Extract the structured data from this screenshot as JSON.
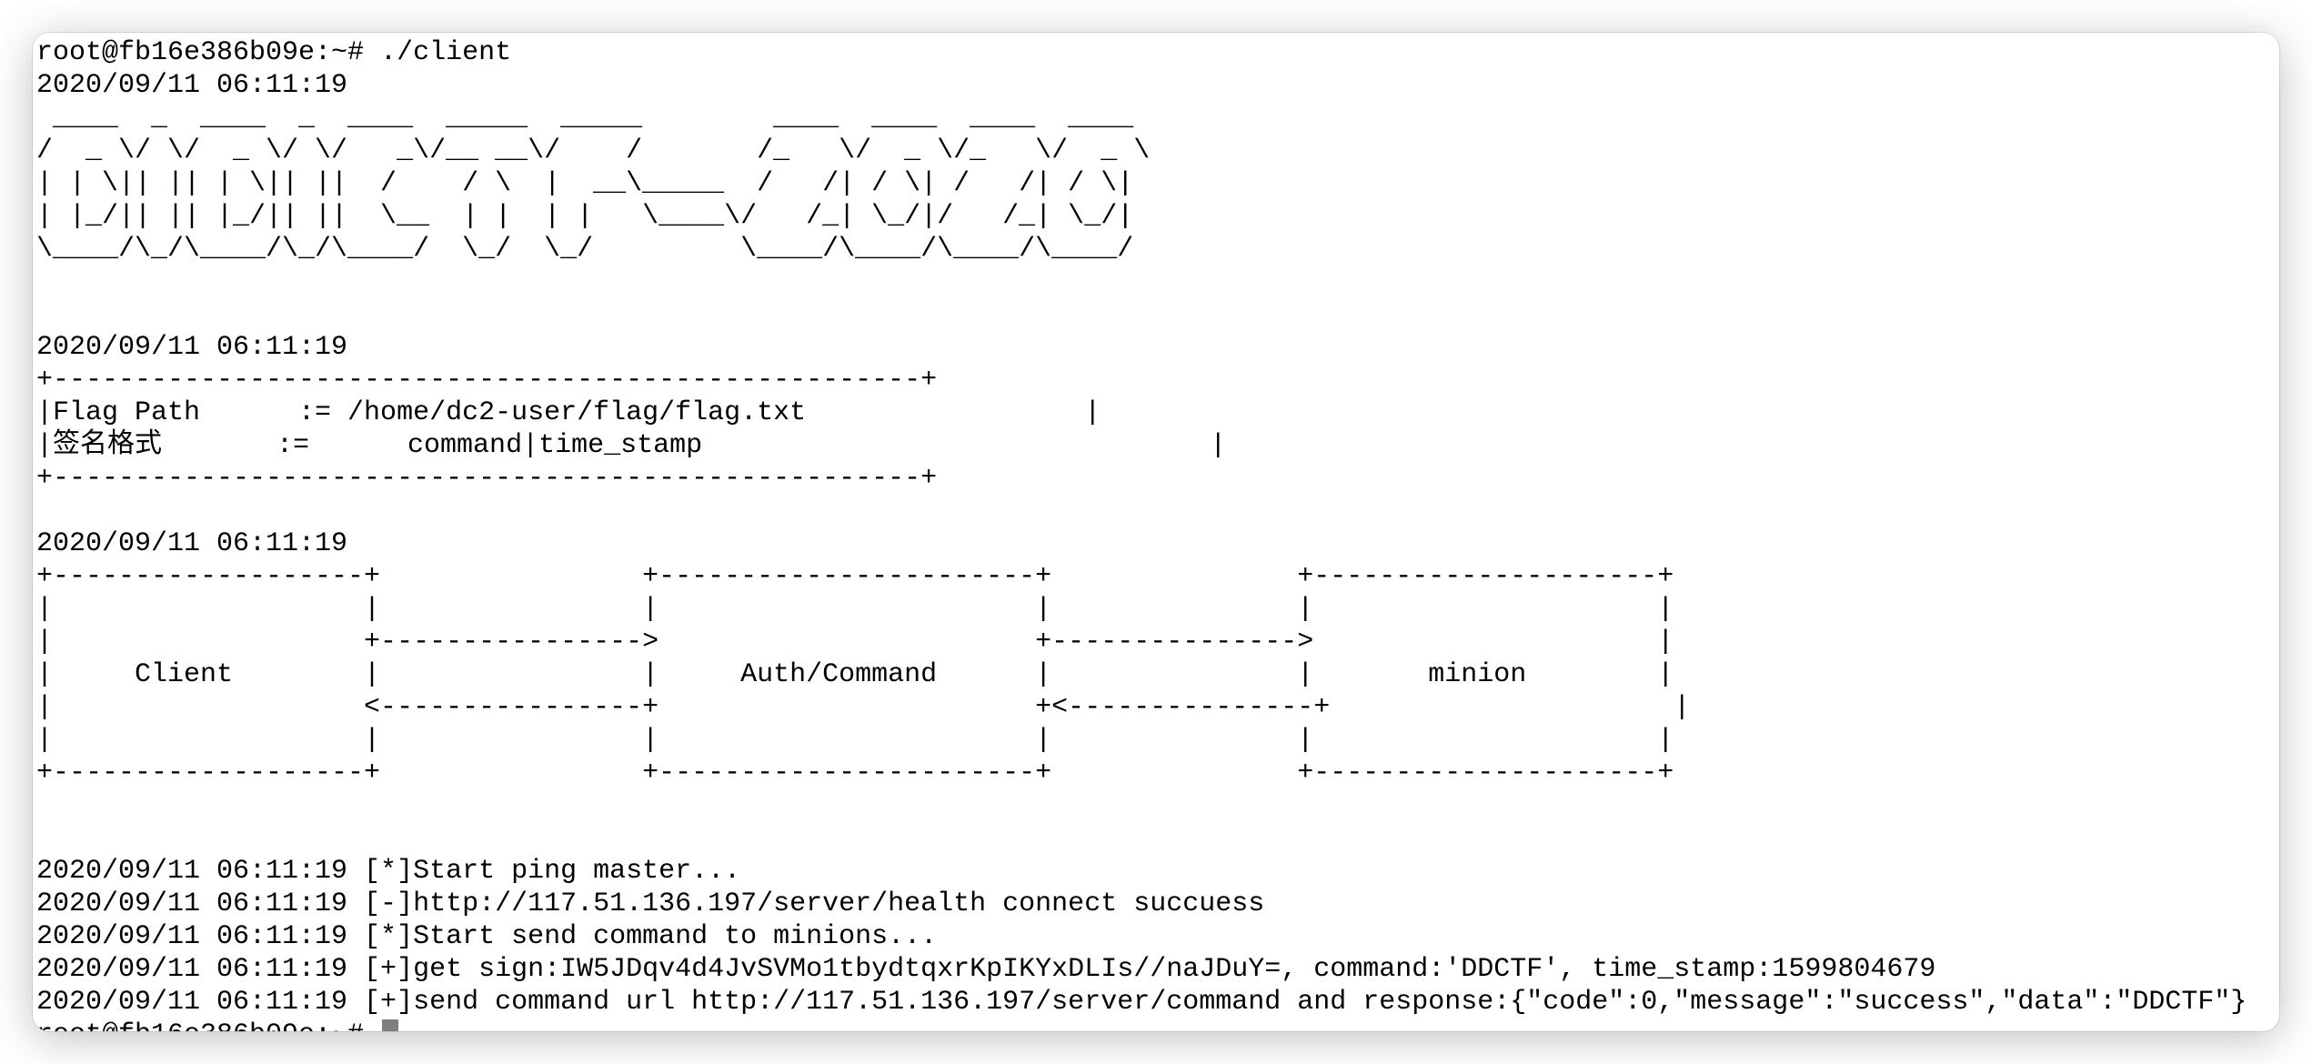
{
  "terminal": {
    "lines": [
      "root@fb16e386b09e:~# ./client",
      "2020/09/11 06:11:19",
      " ____  _  ____  _  ____  _____  _____        ____  ____  ____  ____",
      "/  _ \\/ \\/  _ \\/ \\/   _\\/__ __\\/    /       /_   \\/  _ \\/_   \\/  _ \\",
      "| | \\|| || | \\|| ||  /    / \\  |  __\\_____  /   /| / \\| /   /| / \\|",
      "| |_/|| || |_/|| ||  \\__  | |  | |   \\____\\/   /_| \\_/|/   /_| \\_/|",
      "\\____/\\_/\\____/\\_/\\____/  \\_/  \\_/         \\____/\\____/\\____/\\____/",
      "",
      "",
      "2020/09/11 06:11:19",
      "+-----------------------------------------------------+",
      "|Flag Path      := /home/dc2-user/flag/flag.txt                 |",
      "|签名格式       :=      command|time_stamp                               |",
      "+-----------------------------------------------------+",
      "",
      "2020/09/11 06:11:19",
      "+-------------------+                +-----------------------+               +---------------------+",
      "|                   |                |                       |               |                     |",
      "|                   +---------------->                       +--------------->                     |",
      "|     Client        |                |     Auth/Command      |               |       minion        |",
      "|                   <----------------+                       +<---------------+                     |",
      "|                   |                |                       |               |                     |",
      "+-------------------+                +-----------------------+               +---------------------+",
      "",
      "",
      "2020/09/11 06:11:19 [*]Start ping master...",
      "2020/09/11 06:11:19 [-]http://117.51.136.197/server/health connect succuess",
      "2020/09/11 06:11:19 [*]Start send command to minions...",
      "2020/09/11 06:11:19 [+]get sign:IW5JDqv4d4JvSVMo1tbydtqxrKpIKYxDLIs//naJDuY=, command:'DDCTF', time_stamp:1599804679",
      "2020/09/11 06:11:19 [+]send command url http://117.51.136.197/server/command and response:{\"code\":0,\"message\":\"success\",\"data\":\"DDCTF\"}"
    ],
    "prompt": "root@fb16e386b09e:~# "
  }
}
